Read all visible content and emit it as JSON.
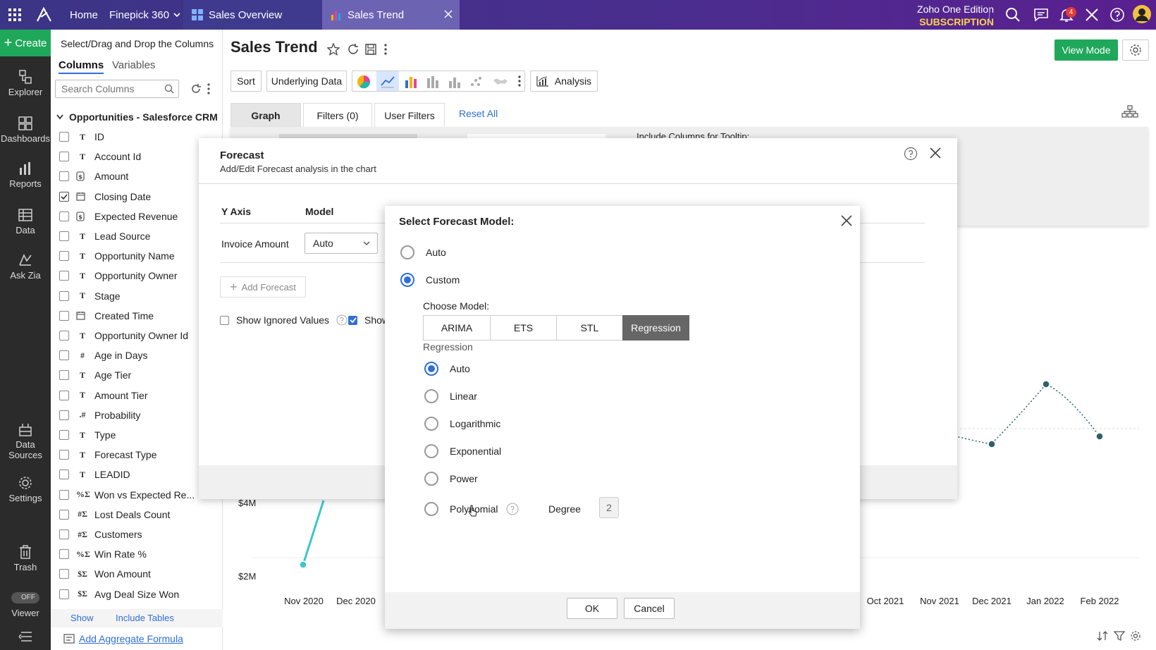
{
  "topbar": {
    "home": "Home",
    "workspace": "Finepick 360",
    "tab1": "Sales Overview",
    "tab2": "Sales Trend",
    "edition_line1": "Zoho One Edition",
    "edition_line2": "SUBSCRIPTION",
    "notification_count": "4"
  },
  "rail": {
    "create": "Create",
    "explorer": "Explorer",
    "dashboards": "Dashboards",
    "reports": "Reports",
    "data": "Data",
    "ask_zia": "Ask Zia",
    "data_sources_1": "Data",
    "data_sources_2": "Sources",
    "settings": "Settings",
    "trash": "Trash",
    "viewer_toggle": "OFF",
    "viewer": "Viewer"
  },
  "panel": {
    "header": "Select/Drag and Drop the Columns",
    "tab_columns": "Columns",
    "tab_variables": "Variables",
    "search_placeholder": "Search Columns",
    "table_name": "Opportunities - Salesforce CRM",
    "columns": [
      {
        "name": "ID",
        "type": "T",
        "checked": false
      },
      {
        "name": "Account Id",
        "type": "T",
        "checked": false
      },
      {
        "name": "Amount",
        "type": "$",
        "checked": false
      },
      {
        "name": "Closing Date",
        "type": "date",
        "checked": true
      },
      {
        "name": "Expected Revenue",
        "type": "$",
        "checked": false
      },
      {
        "name": "Lead Source",
        "type": "T",
        "checked": false
      },
      {
        "name": "Opportunity Name",
        "type": "T",
        "checked": false
      },
      {
        "name": "Opportunity Owner",
        "type": "T",
        "checked": false
      },
      {
        "name": "Stage",
        "type": "T",
        "checked": false
      },
      {
        "name": "Created Time",
        "type": "date",
        "checked": false
      },
      {
        "name": "Opportunity Owner Id",
        "type": "T",
        "checked": false
      },
      {
        "name": "Age in Days",
        "type": "#",
        "checked": false
      },
      {
        "name": "Age Tier",
        "type": "T",
        "checked": false
      },
      {
        "name": "Amount Tier",
        "type": "T",
        "checked": false
      },
      {
        "name": "Probability",
        "type": ".#",
        "checked": false
      },
      {
        "name": "Type",
        "type": "T",
        "checked": false
      },
      {
        "name": "Forecast Type",
        "type": "T",
        "checked": false
      },
      {
        "name": "LEADID",
        "type": "T",
        "checked": false
      },
      {
        "name": "Won vs Expected Re...",
        "type": "%Σ",
        "checked": false
      },
      {
        "name": "Lost Deals Count",
        "type": "#Σ",
        "checked": false
      },
      {
        "name": "Customers",
        "type": "#Σ",
        "checked": false
      },
      {
        "name": "Win Rate %",
        "type": "%Σ",
        "checked": false
      },
      {
        "name": "Won Amount",
        "type": "$Σ",
        "checked": false
      },
      {
        "name": "Avg Deal Size Won",
        "type": "$Σ",
        "checked": false
      }
    ],
    "show": "Show",
    "include_tables": "Include Tables",
    "add_aggregate": "Add Aggregate Formula"
  },
  "report": {
    "title": "Sales Trend",
    "view_mode": "View Mode",
    "sort": "Sort",
    "underlying_data": "Underlying Data",
    "analysis": "Analysis",
    "tab_graph": "Graph",
    "tab_filters": "Filters (0)",
    "tab_user_filters": "User Filters",
    "reset_all": "Reset All",
    "tooltip_label": "Include Columns for Tooltip:"
  },
  "chart": {
    "y_ticks": [
      "$4M",
      "$2M"
    ],
    "x_ticks": [
      "Nov 2020",
      "Dec 2020",
      "Oct 2021",
      "Nov 2021",
      "Dec 2021",
      "Jan 2022",
      "Feb 2022"
    ]
  },
  "forecast": {
    "title": "Forecast",
    "subtitle": "Add/Edit Forecast analysis in the chart",
    "col_y_axis": "Y Axis",
    "col_model": "Model",
    "y_value": "Invoice Amount",
    "model_value": "Auto",
    "add_forecast": "Add Forecast",
    "show_ignored": "Show Ignored Values",
    "show_other": "Show"
  },
  "model_dialog": {
    "title": "Select Forecast Model:",
    "opt_auto": "Auto",
    "opt_custom": "Custom",
    "choose_model": "Choose Model:",
    "models": [
      "ARIMA",
      "ETS",
      "STL",
      "Regression"
    ],
    "selected_model": "Regression",
    "section": "Regression",
    "reg_options": [
      "Auto",
      "Linear",
      "Logarithmic",
      "Exponential",
      "Power",
      "Polynomial"
    ],
    "degree_label": "Degree",
    "degree_value": "2",
    "ok": "OK",
    "cancel": "Cancel"
  },
  "colors": {
    "accent_green": "#1fa85a",
    "radio_blue": "#2f6fd6",
    "forecast_line": "#3cc6c8",
    "link_blue": "#2f6fd6"
  }
}
